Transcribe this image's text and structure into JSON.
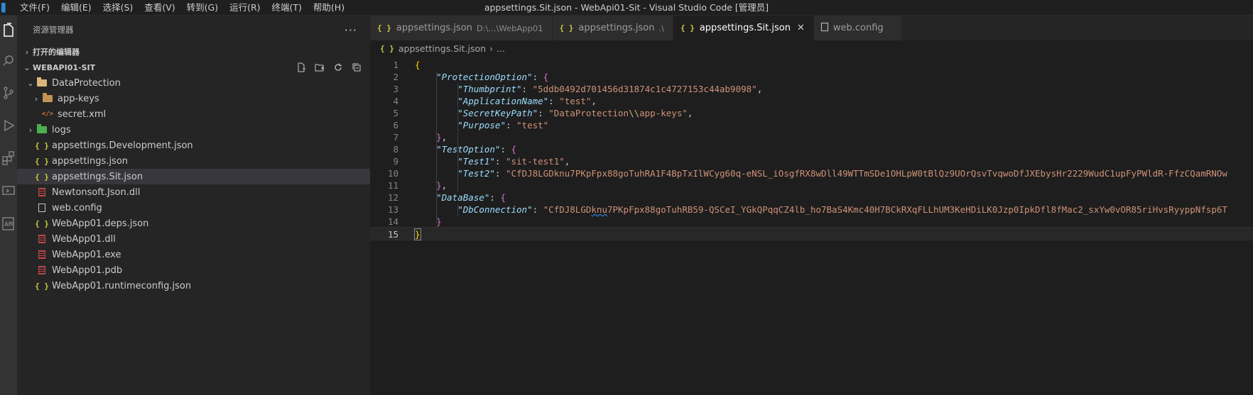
{
  "window": {
    "title": "appsettings.Sit.json - WebApi01-Sit - Visual Studio Code [管理员]"
  },
  "menu": [
    "文件(F)",
    "编辑(E)",
    "选择(S)",
    "查看(V)",
    "转到(G)",
    "运行(R)",
    "终端(T)",
    "帮助(H)"
  ],
  "activity_bar": [
    "explorer-icon",
    "search-icon",
    "source-control-icon",
    "run-debug-icon",
    "extensions-icon",
    "remote-explorer-icon",
    "api-icon"
  ],
  "sidebar": {
    "title": "资源管理器",
    "more": "···",
    "open_editors": "打开的编辑器",
    "project": "WEBAPI01-SIT",
    "tree": [
      {
        "label": "DataProtection",
        "icon": "folder-open-icon",
        "indent": 0,
        "twisty": "⌄"
      },
      {
        "label": "app-keys",
        "icon": "folder-icon",
        "indent": 1,
        "twisty": "›"
      },
      {
        "label": "secret.xml",
        "icon": "xml-icon",
        "indent": 1,
        "twisty": ""
      },
      {
        "label": "logs",
        "icon": "logs-folder-icon",
        "indent": 0,
        "twisty": "›"
      },
      {
        "label": "appsettings.Development.json",
        "icon": "json-icon",
        "indent": 0,
        "twisty": ""
      },
      {
        "label": "appsettings.json",
        "icon": "json-icon",
        "indent": 0,
        "twisty": ""
      },
      {
        "label": "appsettings.Sit.json",
        "icon": "json-icon",
        "indent": 0,
        "twisty": "",
        "selected": true
      },
      {
        "label": "Newtonsoft.Json.dll",
        "icon": "dll-icon",
        "indent": 0,
        "twisty": ""
      },
      {
        "label": "web.config",
        "icon": "file-icon",
        "indent": 0,
        "twisty": ""
      },
      {
        "label": "WebApp01.deps.json",
        "icon": "json-icon",
        "indent": 0,
        "twisty": ""
      },
      {
        "label": "WebApp01.dll",
        "icon": "dll-icon",
        "indent": 0,
        "twisty": ""
      },
      {
        "label": "WebApp01.exe",
        "icon": "dll-icon",
        "indent": 0,
        "twisty": ""
      },
      {
        "label": "WebApp01.pdb",
        "icon": "dll-icon",
        "indent": 0,
        "twisty": ""
      },
      {
        "label": "WebApp01.runtimeconfig.json",
        "icon": "json-icon",
        "indent": 0,
        "twisty": ""
      }
    ]
  },
  "tabs": [
    {
      "label": "appsettings.json",
      "description": "D:\\...\\WebApp01",
      "icon": "json-icon",
      "active": false
    },
    {
      "label": "appsettings.json",
      "description": ".\\",
      "icon": "json-icon",
      "active": false
    },
    {
      "label": "appsettings.Sit.json",
      "description": "",
      "icon": "json-icon",
      "active": true,
      "close": "✕"
    },
    {
      "label": "web.config",
      "description": "",
      "icon": "file-icon",
      "active": false
    }
  ],
  "breadcrumb": {
    "file": "appsettings.Sit.json",
    "sep": "›",
    "rest": "..."
  },
  "editor": {
    "current_line": 15,
    "lines": [
      {
        "n": "1",
        "indent": 0,
        "tokens": [
          [
            "b1",
            "{"
          ]
        ]
      },
      {
        "n": "2",
        "indent": 1,
        "tokens": [
          [
            "key",
            "\"ProtectionOption\""
          ],
          [
            "p",
            ": "
          ],
          [
            "b2",
            "{"
          ]
        ]
      },
      {
        "n": "3",
        "indent": 2,
        "tokens": [
          [
            "key",
            "\"Thumbprint\""
          ],
          [
            "p",
            ": "
          ],
          [
            "str",
            "\"5ddb0492d701456d31874c1c4727153c44ab9098\""
          ],
          [
            "p",
            ","
          ]
        ]
      },
      {
        "n": "4",
        "indent": 2,
        "tokens": [
          [
            "key",
            "\"ApplicationName\""
          ],
          [
            "p",
            ": "
          ],
          [
            "str",
            "\"test\""
          ],
          [
            "p",
            ","
          ]
        ]
      },
      {
        "n": "5",
        "indent": 2,
        "tokens": [
          [
            "key",
            "\"SecretKeyPath\""
          ],
          [
            "p",
            ": "
          ],
          [
            "str",
            "\"DataProtection"
          ],
          [
            "esc",
            "\\\\"
          ],
          [
            "str",
            "app-keys\""
          ],
          [
            "p",
            ","
          ]
        ]
      },
      {
        "n": "6",
        "indent": 2,
        "tokens": [
          [
            "key",
            "\"Purpose\""
          ],
          [
            "p",
            ": "
          ],
          [
            "str",
            "\"test\""
          ]
        ]
      },
      {
        "n": "7",
        "indent": 1,
        "tokens": [
          [
            "b2",
            "}"
          ],
          [
            "p",
            ","
          ]
        ]
      },
      {
        "n": "8",
        "indent": 1,
        "tokens": [
          [
            "key",
            "\"TestOption\""
          ],
          [
            "p",
            ": "
          ],
          [
            "b2",
            "{"
          ]
        ]
      },
      {
        "n": "9",
        "indent": 2,
        "tokens": [
          [
            "key",
            "\"Test1\""
          ],
          [
            "p",
            ": "
          ],
          [
            "str",
            "\"sit-test1\""
          ],
          [
            "p",
            ","
          ]
        ]
      },
      {
        "n": "10",
        "indent": 2,
        "tokens": [
          [
            "key",
            "\"Test2\""
          ],
          [
            "p",
            ": "
          ],
          [
            "str",
            "\"CfDJ8LGDknu7PKpFpx88goTuhRA1F4BpTxIlWCyg60q-eNSL_iOsgfRX8wDll49WTTmSDe1OHLpW0tBlQz9UOrQsvTvqwoDfJXEbysHr2229WudC1upFyPWldR-FfzCQamRNOw"
          ]
        ]
      },
      {
        "n": "11",
        "indent": 1,
        "tokens": [
          [
            "b2",
            "}"
          ],
          [
            "p",
            ","
          ]
        ]
      },
      {
        "n": "12",
        "indent": 1,
        "tokens": [
          [
            "key",
            "\"DataBase\""
          ],
          [
            "p",
            ": "
          ],
          [
            "b2",
            "{"
          ]
        ]
      },
      {
        "n": "13",
        "indent": 2,
        "tokens": [
          [
            "key",
            "\"DbConnection\""
          ],
          [
            "p",
            ": "
          ],
          [
            "str",
            "\"CfDJ8LGD"
          ],
          [
            "sq",
            "knu"
          ],
          [
            "str",
            "7PKpFpx88goTuhRB59-QSCeI_YGkQPqqCZ4lb_ho7BaS4Kmc40H7BCkRXqFLLhUM3KeHDiLK0Jzp0IpkDfl8fMac2_sxYw0vOR85riHvsRyyppNfsp6T"
          ]
        ]
      },
      {
        "n": "14",
        "indent": 1,
        "tokens": [
          [
            "b2",
            "}"
          ]
        ]
      },
      {
        "n": "15",
        "indent": 0,
        "tokens": [
          [
            "b1box",
            "}"
          ]
        ]
      }
    ]
  }
}
